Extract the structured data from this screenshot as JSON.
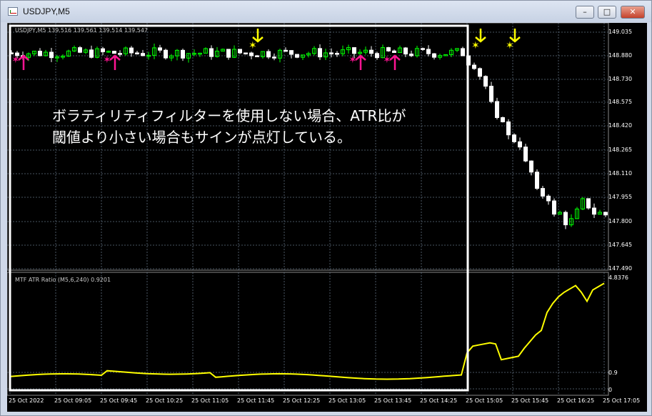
{
  "window": {
    "title": "USDJPY,M5",
    "minimize": "–",
    "maximize": "□",
    "close": "✕"
  },
  "main_pane": {
    "header": "USDJPY,M5  139.516 139.561 139.514 139.547",
    "price_axis": [
      "149.035",
      "148.880",
      "148.730",
      "148.575",
      "148.420",
      "148.265",
      "148.110",
      "147.955",
      "147.800",
      "147.645",
      "147.490"
    ]
  },
  "annotation": {
    "line1": "ボラティリティフィルターを使用しない場合、ATR比が",
    "line2": "閾値より小さい場合もサインが点灯している。"
  },
  "sub_pane": {
    "header": "MTF ATR Ratio  (M5,6,240) 0.9201",
    "axis": [
      "4.8376",
      "0.9",
      "0"
    ]
  },
  "time_axis": [
    "25 Oct 2022",
    "25 Oct 09:05",
    "25 Oct 09:45",
    "25 Oct 10:25",
    "25 Oct 11:05",
    "25 Oct 11:45",
    "25 Oct 12:25",
    "25 Oct 13:05",
    "25 Oct 13:45",
    "25 Oct 14:25",
    "25 Oct 15:05",
    "25 Oct 15:45",
    "25 Oct 16:25",
    "25 Oct 17:05"
  ],
  "colors": {
    "bull": "#00ff00",
    "bear": "#ffffff",
    "buy_arrow": "#ff1493",
    "sell_arrow": "#ffff00",
    "atr_line": "#ffff00",
    "grid": "#5f6f7f",
    "highlight_box": "#ffffff"
  },
  "signals": {
    "buy": [
      1,
      17,
      60,
      66
    ],
    "sell": [
      42,
      81,
      87
    ]
  }
}
